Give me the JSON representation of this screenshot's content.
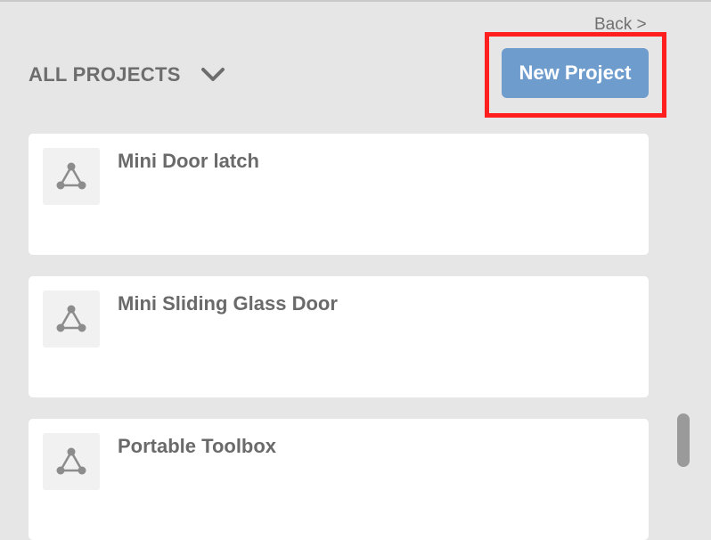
{
  "nav": {
    "back_label": "Back >"
  },
  "header": {
    "title": "ALL PROJECTS",
    "dropdown_icon": "chevron-down-icon"
  },
  "actions": {
    "new_project_label": "New Project",
    "new_project_color": "#6e9ccd",
    "highlight_color": "#ff1f1f"
  },
  "projects": [
    {
      "name": "Mini Door latch",
      "icon": "triangle-network-icon"
    },
    {
      "name": "Mini Sliding Glass Door",
      "icon": "triangle-network-icon"
    },
    {
      "name": "Portable Toolbox",
      "icon": "triangle-network-icon"
    }
  ]
}
